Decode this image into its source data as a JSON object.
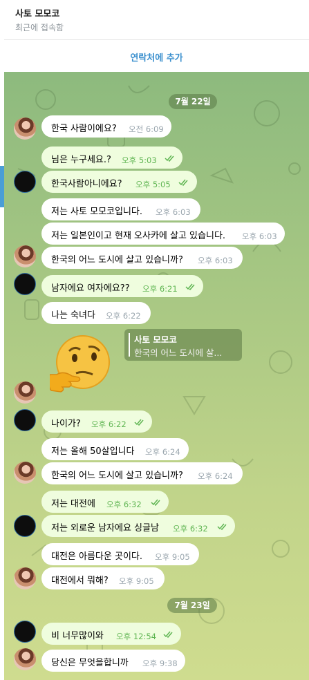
{
  "header": {
    "name": "사토 모모코",
    "status": "최근에 접속함"
  },
  "add_contact": {
    "label": "연락처에 추가"
  },
  "dates": {
    "d1": "7월 22일",
    "d2": "7월 23일"
  },
  "messages": [
    {
      "text": "한국 사람이에요?",
      "time": "오전 6:09"
    },
    {
      "text": "님은 누구세요.?",
      "time": "오후 5:03"
    },
    {
      "text": "한국사람아니에요?",
      "time": "오후 5:05"
    },
    {
      "text": "저는 사토 모모코입니다.",
      "time": "오후 6:03"
    },
    {
      "text": "저는 일본인이고 현재 오사카에 살고 있습니다.",
      "time": "오후 6:03"
    },
    {
      "text": "한국의 어느 도시에 살고 있습니까?",
      "time": "오후 6:03"
    },
    {
      "text": "남자에요 여자에요??",
      "time": "오후 6:21"
    },
    {
      "text": "나는 숙녀다",
      "time": "오후 6:22"
    },
    {
      "text": "나이가?",
      "time": "오후 6:22"
    },
    {
      "text": "저는 올해 50살입니다",
      "time": "오후 6:24"
    },
    {
      "text": "한국의 어느 도시에 살고 있습니까?",
      "time": "오후 6:24"
    },
    {
      "text": "저는 대전에",
      "time": "오후 6:32"
    },
    {
      "text": "저는 외로운 남자에요 싱글남",
      "time": "오후 6:32"
    },
    {
      "text": "대전은 아름다운 곳이다.",
      "time": "오후 9:05"
    },
    {
      "text": "대전에서 뭐해?",
      "time": "오후 9:05"
    },
    {
      "text": "비 너무많이와",
      "time": "오후 12:54"
    },
    {
      "text": "당신은 무엇을합니까",
      "time": "오후 9:38"
    }
  ],
  "reply": {
    "name": "사토 모모코",
    "text": "한국의 어느 도시에 살..."
  },
  "colors": {
    "outgoing_bubble": "#effdde",
    "incoming_bubble": "#ffffff",
    "accent": "#3a8fce",
    "check": "#5fb552"
  }
}
